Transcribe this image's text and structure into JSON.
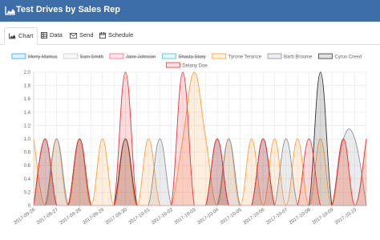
{
  "header": {
    "title": "Test Drives by Sales Rep",
    "icon": "area-chart-icon"
  },
  "tabs": [
    {
      "label": "Chart",
      "icon": "area-chart-icon",
      "active": true
    },
    {
      "label": "Data",
      "icon": "table-icon",
      "active": false
    },
    {
      "label": "Send",
      "icon": "envelope-icon",
      "active": false
    },
    {
      "label": "Schedule",
      "icon": "calendar-icon",
      "active": false
    }
  ],
  "chart_data": {
    "type": "area",
    "title": "",
    "xlabel": "",
    "ylabel": "",
    "ylim": [
      0,
      2.0
    ],
    "yticks": [
      "0",
      "0.2",
      "0.4",
      "0.6",
      "0.8",
      "1.0",
      "1.2",
      "1.4",
      "1.6",
      "1.8",
      "2.0"
    ],
    "grid": true,
    "legend_position": "top",
    "x": [
      "2017-09-26",
      "2017-09-26",
      "2017-09-27",
      "2017-09-27",
      "2017-09-28",
      "2017-09-28",
      "2017-09-29",
      "2017-09-29",
      "2017-09-30",
      "2017-09-30",
      "2017-10-01",
      "2017-10-01",
      "2017-10-02",
      "2017-10-02",
      "2017-10-03",
      "2017-10-03",
      "2017-10-04",
      "2017-10-04",
      "2017-10-05",
      "2017-10-05",
      "2017-10-06",
      "2017-10-06",
      "2017-10-07",
      "2017-10-07",
      "2017-10-08",
      "2017-10-08",
      "2017-10-09",
      "2017-10-09",
      "2017-10-10",
      "2017-10-10"
    ],
    "series": [
      {
        "name": "Merry Markus",
        "hidden": true,
        "stroke": "#36a2eb",
        "fill": "#36a2eb",
        "values": []
      },
      {
        "name": "Sam Smith",
        "hidden": true,
        "stroke": "#c9cbcf",
        "fill": "#c9cbcf",
        "values": []
      },
      {
        "name": "Jane Johnson",
        "hidden": true,
        "stroke": "#ff6384",
        "fill": "#ff6384",
        "values": []
      },
      {
        "name": "Shasta Story",
        "hidden": true,
        "stroke": "#4bc0c0",
        "fill": "#4bc0c0",
        "values": []
      },
      {
        "name": "Tyrone Terance",
        "hidden": false,
        "stroke": "#ff9f40",
        "fill": "#ff9f40",
        "values": [
          1,
          0,
          1,
          0,
          1,
          0,
          1,
          0,
          1,
          0,
          1,
          0,
          0,
          1,
          2,
          1,
          0,
          1,
          0,
          1,
          0,
          1,
          0,
          1,
          0,
          1,
          0,
          1,
          0,
          1
        ]
      },
      {
        "name": "Barb Broome",
        "hidden": false,
        "stroke": "#8a9099",
        "fill": "#8a9099",
        "values": [
          0,
          0,
          1,
          0,
          0,
          0,
          0,
          0,
          0,
          0,
          0,
          1,
          0,
          0,
          0,
          0,
          0,
          1,
          0,
          0,
          0,
          0,
          1,
          0,
          0,
          0,
          0,
          1,
          1,
          0
        ]
      },
      {
        "name": "Cyrus Creed",
        "hidden": false,
        "stroke": "#333333",
        "fill": "#333333",
        "values": [
          0,
          1,
          0,
          0,
          1,
          0,
          0,
          0,
          1,
          0,
          0,
          0,
          0,
          0,
          0,
          0,
          1,
          0,
          0,
          0,
          1,
          0,
          0,
          0,
          0,
          2,
          0,
          0,
          0,
          0
        ]
      },
      {
        "name": "Delany Doe",
        "hidden": false,
        "stroke": "#e8353e",
        "fill": "#e8353e",
        "values": [
          0,
          1,
          0,
          0,
          1,
          0,
          0,
          0,
          2,
          0,
          0,
          0,
          0,
          2,
          0,
          0,
          1,
          0,
          0,
          0,
          1,
          0,
          0,
          0,
          1,
          0,
          0,
          1,
          0,
          1
        ]
      }
    ]
  }
}
